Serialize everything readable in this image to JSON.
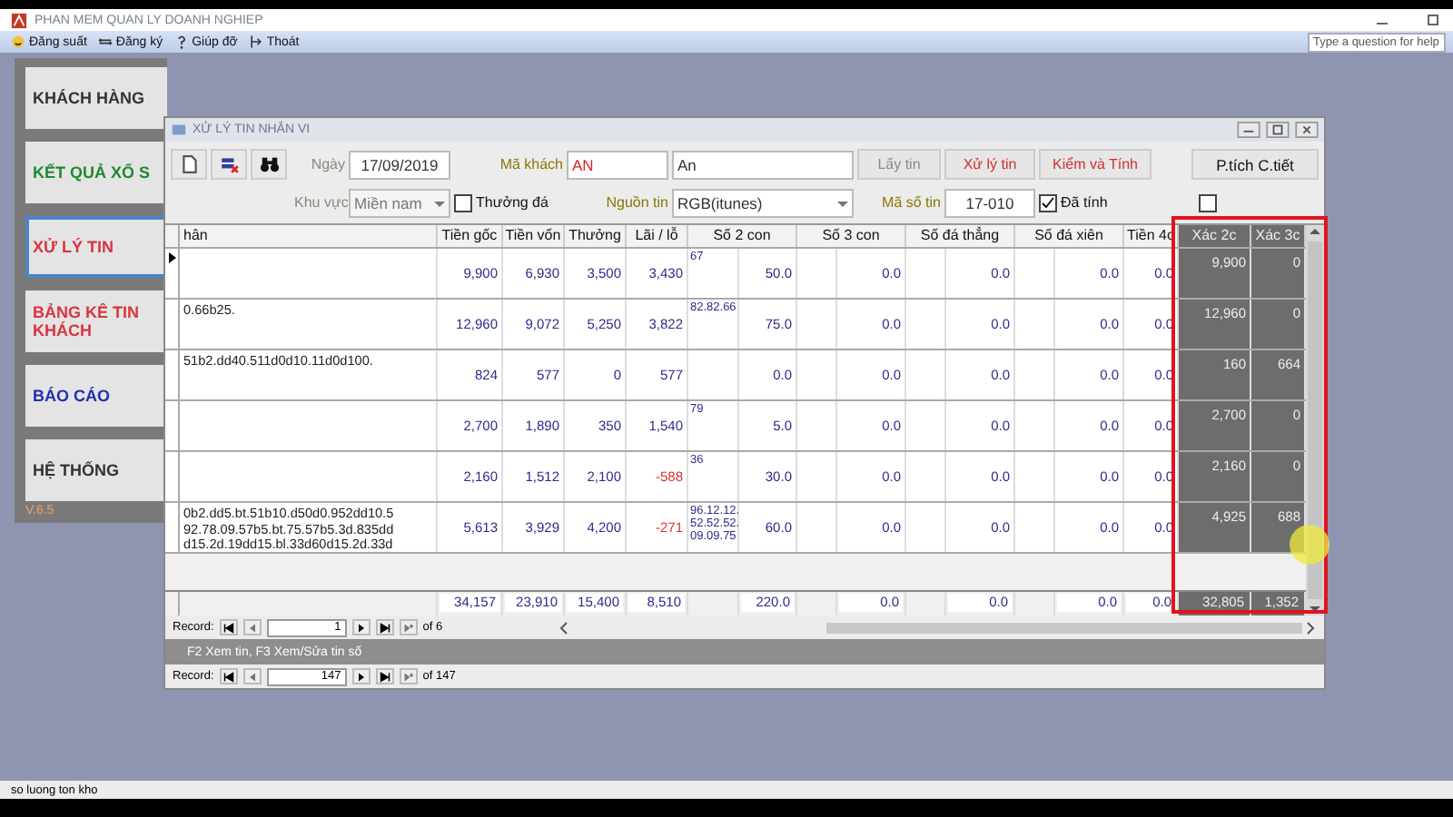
{
  "app": {
    "title": "PHAN MEM QUAN LY DOANH NGHIEP"
  },
  "menu": [
    {
      "label": "Đăng suất"
    },
    {
      "label": "Đăng ký"
    },
    {
      "label": "Giúp đỡ"
    },
    {
      "label": "Thoát"
    }
  ],
  "help_box": {
    "placeholder": "Type a question for help"
  },
  "nav_panel": {
    "items": [
      {
        "label": "KHÁCH HÀNG",
        "color": "#333333",
        "selected": false
      },
      {
        "label": "KẾT QUẢ XỔ S",
        "color": "#1e8a2e",
        "selected": false
      },
      {
        "label": "XỬ LÝ TIN",
        "color": "#d9343f",
        "selected": true
      },
      {
        "label": "BẢNG KÊ TIN KHÁCH",
        "color": "#d9343f",
        "selected": false
      },
      {
        "label": "BÁO CÁO",
        "color": "#1f2fb3",
        "selected": false
      },
      {
        "label": "HỆ THỐNG",
        "color": "#333333",
        "selected": false
      }
    ],
    "version": "V.6.5"
  },
  "window": {
    "title": "XỬ LÝ TIN NHẮN VI",
    "form": {
      "date": {
        "label": "Ngày",
        "value": "17/09/2019",
        "disabled": true
      },
      "region": {
        "label": "Khu vực",
        "value": "Miền nam",
        "disabled": true
      },
      "customer": {
        "label": "Mã khách",
        "code": "AN",
        "name": "An"
      },
      "thuong_da": {
        "label": "Thưởng đá",
        "checked": false
      },
      "source": {
        "label": "Nguồn tin",
        "value": "RGB(itunes)"
      },
      "message_no": {
        "label": "Mã số tin",
        "value": "17-010"
      },
      "da_tinh": {
        "label": "Đã tính",
        "checked": true
      },
      "extra_check": {
        "checked": false
      },
      "buttons": [
        {
          "label": "Lấy tin",
          "kind": "action",
          "disabled": true
        },
        {
          "label": "Xử lý tin",
          "kind": "action",
          "disabled": false
        },
        {
          "label": "Kiểm và Tính",
          "kind": "action",
          "disabled": false
        },
        {
          "label": "P.tích C.tiết",
          "kind": "plain",
          "disabled": false
        }
      ]
    },
    "table": {
      "columns": [
        "hân",
        "Tiền gốc",
        "Tiền vốn",
        "Thưởng",
        "Lãi / lỗ",
        "Số 2 con",
        "Số 3 con",
        "Số đá thẳng",
        "Số đá xiên",
        "Tiền 4c",
        "Xác 2c",
        "Xác 3c"
      ],
      "rows": [
        {
          "selected": true,
          "tien_goc": "9,900",
          "tien_von": "6,930",
          "thuong": "3,500",
          "lai_lo": "3,430",
          "loss": false,
          "so_2_con_numbers": "67",
          "so_2_con": "50.0",
          "so_3_con": "0.0",
          "so_da_thang": "0.0",
          "so_da_xien": "0.0",
          "tien_4c": "0.0",
          "xac_2c": "9,900",
          "xac_3c": "0"
        },
        {
          "selected": false,
          "text": "0.66b25.",
          "tien_goc": "12,960",
          "tien_von": "9,072",
          "thuong": "5,250",
          "lai_lo": "3,822",
          "loss": false,
          "so_2_con_numbers": "82.82.66",
          "so_2_con": "75.0",
          "so_3_con": "0.0",
          "so_da_thang": "0.0",
          "so_da_xien": "0.0",
          "tien_4c": "0.0",
          "xac_2c": "12,960",
          "xac_3c": "0"
        },
        {
          "selected": false,
          "text": "51b2.dd40.511d0d10.11d0d100.",
          "tien_goc": "824",
          "tien_von": "577",
          "thuong": "0",
          "lai_lo": "577",
          "loss": false,
          "so_2_con": "0.0",
          "so_3_con": "0.0",
          "so_da_thang": "0.0",
          "so_da_xien": "0.0",
          "tien_4c": "0.0",
          "xac_2c": "160",
          "xac_3c": "664"
        },
        {
          "selected": false,
          "tien_goc": "2,700",
          "tien_von": "1,890",
          "thuong": "350",
          "lai_lo": "1,540",
          "loss": false,
          "so_2_con_numbers": "79",
          "so_2_con": "5.0",
          "so_3_con": "0.0",
          "so_da_thang": "0.0",
          "so_da_xien": "0.0",
          "tien_4c": "0.0",
          "xac_2c": "2,700",
          "xac_3c": "0"
        },
        {
          "selected": false,
          "tien_goc": "2,160",
          "tien_von": "1,512",
          "thuong": "2,100",
          "lai_lo": "-588",
          "loss": true,
          "so_2_con_numbers": "36",
          "so_2_con": "30.0",
          "so_3_con": "0.0",
          "so_da_thang": "0.0",
          "so_da_xien": "0.0",
          "tien_4c": "0.0",
          "xac_2c": "2,160",
          "xac_3c": "0"
        },
        {
          "selected": false,
          "text": "0b2.dd5.bt.51b10.d50d0.952dd10.5 92.78.09.57b5.bt.75.57b5.3d.835dd d15.2d.19dd15.bl.33d60d15.2d.33d",
          "tien_goc": "5,613",
          "tien_von": "3,929",
          "thuong": "4,200",
          "lai_lo": "-271",
          "loss": true,
          "so_2_con_numbers": "96.12.12. 52.52.52. 09.09.75",
          "so_2_con": "60.0",
          "so_3_con": "0.0",
          "so_da_thang": "0.0",
          "so_da_xien": "0.0",
          "tien_4c": "0.0",
          "xac_2c": "4,925",
          "xac_3c": "688"
        }
      ],
      "totals": {
        "tien_goc": "34,157",
        "tien_von": "23,910",
        "thuong": "15,400",
        "lai_lo": "8,510",
        "so_2_con": "220.0",
        "so_3_con": "0.0",
        "so_da_thang": "0.0",
        "so_da_xien": "0.0",
        "tien_4c": "0.0",
        "xac_2c": "32,805",
        "xac_3c": "1,352"
      }
    },
    "record_nav": {
      "label": "Record:",
      "current": "1",
      "of": "of 6"
    },
    "hint": "F2 Xem tin, F3 Xem/Sửa tin số",
    "record_nav_2": {
      "label": "Record:",
      "current": "147",
      "of": "of 147"
    }
  },
  "status_bar": "so luong ton kho"
}
